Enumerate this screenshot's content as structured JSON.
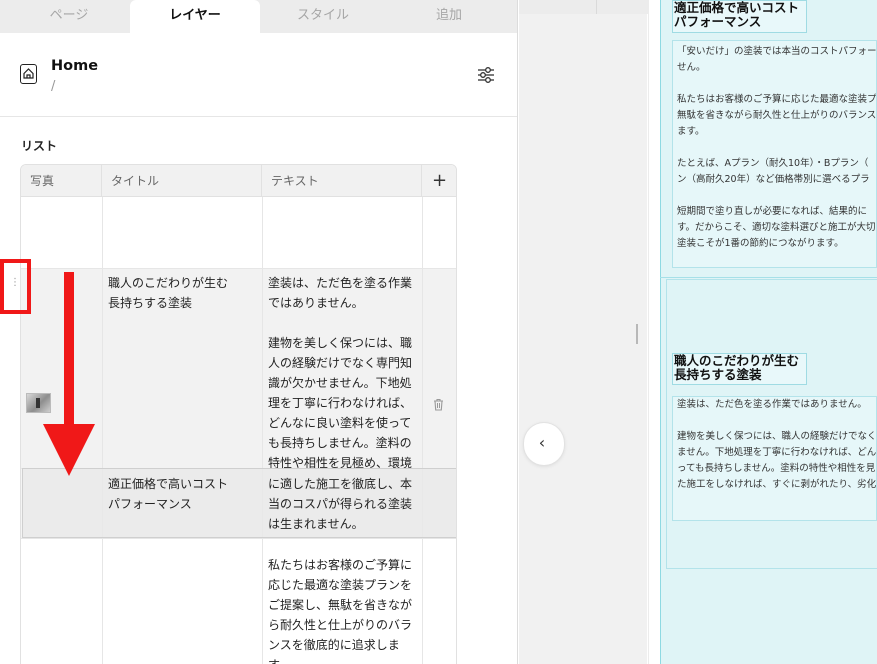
{
  "tabs": [
    {
      "label": "ページ"
    },
    {
      "label": "レイヤー"
    },
    {
      "label": "スタイル"
    },
    {
      "label": "追加"
    }
  ],
  "active_tab": "レイヤー",
  "header": {
    "title": "Home",
    "path": "/"
  },
  "list": {
    "label": "リスト",
    "columns": [
      "写真",
      "タイトル",
      "テキスト"
    ],
    "add_column_label": "+",
    "rows": [
      {
        "title": "職人のこだわりが生む\n長持ちする塗装",
        "text": "塗装は、ただ色を塗る作業\nではありません。\n\n建物を美しく保つには、職\n人の経験だけでなく専門知\n識が欠かせません。下地処\n理を丁寧に行わなければ、\nどんなに良い塗料を使って\nも長持ちしません。塗料の\n特性や相性を見極め、環境\n"
      },
      {
        "title": "適正価格で高いコスト\nパフォーマンス",
        "text": "に適した施工を徹底し、本\n当のコスパが得られる塗装\nは生まれません。"
      },
      {
        "title": "",
        "text": "私たちはお客様のご予算に\n応じた最適な塗装プランを\nご提案し、無駄を省きなが\nら耐久性と仕上がりのバラ\nンスを徹底的に追求しま\nす。"
      }
    ]
  },
  "preview": {
    "heading1": "適正価格で高いコスト\nパフォーマンス",
    "text1": "「安いだけ」の塗装では本当のコストパフォー\nせん。\n\n私たちはお客様のご予算に応じた最適な塗装プ\n無駄を省きながら耐久性と仕上がりのバランス\nます。\n\nたとえば、Aプラン（耐久10年）・Bプラン（\nン（高耐久20年）など価格帯別に選べるプラ\n\n短期間で塗り直しが必要になれば、結果的に\nす。だからこそ、適切な塗料選びと施工が大切\n塗装こそが1番の節約につながります。",
    "heading2": "職人のこだわりが生む\n長持ちする塗装",
    "text2": "塗装は、ただ色を塗る作業ではありません。\n\n建物を美しく保つには、職人の経験だけでなく\nません。下地処理を丁寧に行わなければ、どん\nっても長持ちしません。塗料の特性や相性を見\nた施工をしなければ、すぐに剥がれたり、劣化"
  },
  "colors": {
    "accent_red": "#f01818",
    "preview_frame": "#dff4f6",
    "preview_border": "#8ed9e2"
  }
}
